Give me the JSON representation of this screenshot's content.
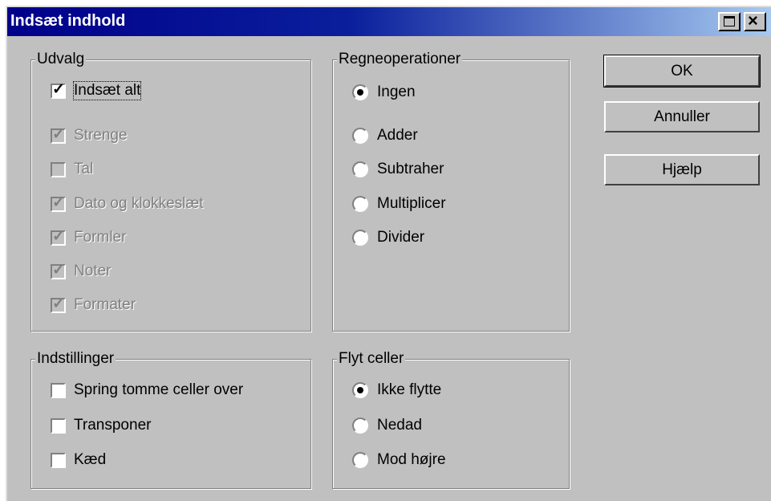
{
  "window": {
    "title": "Indsæt indhold"
  },
  "selection": {
    "legend": "Udvalg",
    "items": [
      {
        "label": "Indsæt alt",
        "checked": true,
        "enabled": true
      },
      {
        "label": "Strenge",
        "checked": true,
        "enabled": false
      },
      {
        "label": "Tal",
        "checked": false,
        "enabled": false
      },
      {
        "label": "Dato og klokkeslæt",
        "checked": true,
        "enabled": false
      },
      {
        "label": "Formler",
        "checked": true,
        "enabled": false
      },
      {
        "label": "Noter",
        "checked": true,
        "enabled": false
      },
      {
        "label": "Formater",
        "checked": true,
        "enabled": false
      }
    ]
  },
  "operations": {
    "legend": "Regneoperationer",
    "selected": "Ingen",
    "items": [
      {
        "label": "Ingen"
      },
      {
        "label": "Adder"
      },
      {
        "label": "Subtraher"
      },
      {
        "label": "Multiplicer"
      },
      {
        "label": "Divider"
      }
    ]
  },
  "options": {
    "legend": "Indstillinger",
    "items": [
      {
        "label": "Spring tomme celler over",
        "checked": false
      },
      {
        "label": "Transponer",
        "checked": false
      },
      {
        "label": "Kæd",
        "checked": false
      }
    ]
  },
  "shift_cells": {
    "legend": "Flyt celler",
    "selected": "Ikke flytte",
    "items": [
      {
        "label": "Ikke flytte"
      },
      {
        "label": "Nedad"
      },
      {
        "label": "Mod højre"
      }
    ]
  },
  "buttons": {
    "ok": "OK",
    "cancel": "Annuller",
    "help": "Hjælp"
  }
}
